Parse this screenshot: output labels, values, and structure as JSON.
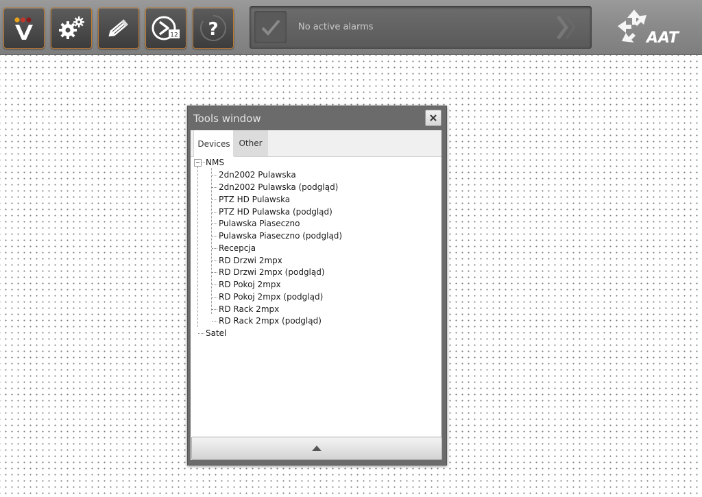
{
  "toolbar": {
    "buttons": [
      {
        "name": "vms-logo-button",
        "icon": "v-logo-icon"
      },
      {
        "name": "settings-button",
        "icon": "gears-icon"
      },
      {
        "name": "edit-button",
        "icon": "pencil-icon"
      },
      {
        "name": "playback-button",
        "icon": "clock-playback-icon",
        "badge": "12"
      },
      {
        "name": "help-button",
        "icon": "help-question-icon",
        "label": "?"
      }
    ],
    "accent_color": "#c07a2e"
  },
  "alarms": {
    "status_text": "No active alarms",
    "check_icon": "checkmark-icon",
    "next_icon": "chevron-right-icon"
  },
  "brand": {
    "logo_text": "AAT"
  },
  "tools_window": {
    "title": "Tools window",
    "close_icon": "close-icon",
    "tabs": [
      {
        "label": "Devices",
        "active": true
      },
      {
        "label": "Other",
        "active": false
      }
    ],
    "tree": {
      "root": "NMS",
      "children": [
        "2dn2002 Pulawska",
        "2dn2002 Pulawska (podgląd)",
        "PTZ HD Pulawska",
        "PTZ HD Pulawska (podgląd)",
        "Pulawska Piaseczno",
        "Pulawska Piaseczno (podgląd)",
        "Recepcja",
        "RD Drzwi 2mpx",
        "RD Drzwi 2mpx (podgląd)",
        "RD Pokoj 2mpx",
        "RD Pokoj 2mpx (podgląd)",
        "RD Rack 2mpx",
        "RD Rack 2mpx (podgląd)"
      ],
      "sibling": "Satel"
    },
    "footer_icon": "arrow-up-icon"
  }
}
